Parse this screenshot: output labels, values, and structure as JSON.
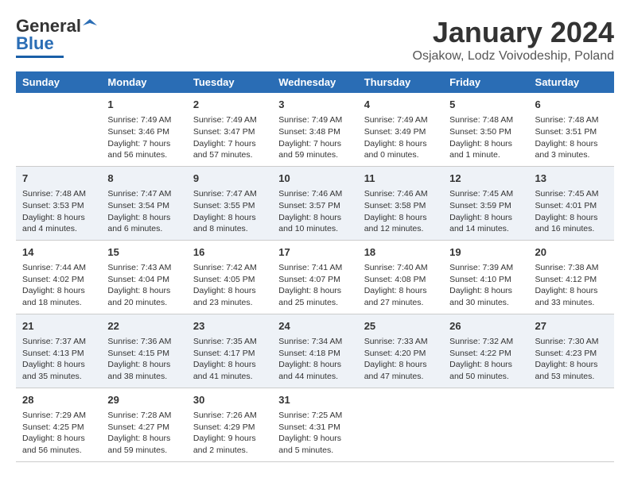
{
  "logo": {
    "line1": "General",
    "line2": "Blue"
  },
  "title": "January 2024",
  "subtitle": "Osjakow, Lodz Voivodeship, Poland",
  "days_of_week": [
    "Sunday",
    "Monday",
    "Tuesday",
    "Wednesday",
    "Thursday",
    "Friday",
    "Saturday"
  ],
  "weeks": [
    [
      {
        "day": "",
        "info": ""
      },
      {
        "day": "1",
        "info": "Sunrise: 7:49 AM\nSunset: 3:46 PM\nDaylight: 7 hours\nand 56 minutes."
      },
      {
        "day": "2",
        "info": "Sunrise: 7:49 AM\nSunset: 3:47 PM\nDaylight: 7 hours\nand 57 minutes."
      },
      {
        "day": "3",
        "info": "Sunrise: 7:49 AM\nSunset: 3:48 PM\nDaylight: 7 hours\nand 59 minutes."
      },
      {
        "day": "4",
        "info": "Sunrise: 7:49 AM\nSunset: 3:49 PM\nDaylight: 8 hours\nand 0 minutes."
      },
      {
        "day": "5",
        "info": "Sunrise: 7:48 AM\nSunset: 3:50 PM\nDaylight: 8 hours\nand 1 minute."
      },
      {
        "day": "6",
        "info": "Sunrise: 7:48 AM\nSunset: 3:51 PM\nDaylight: 8 hours\nand 3 minutes."
      }
    ],
    [
      {
        "day": "7",
        "info": "Sunrise: 7:48 AM\nSunset: 3:53 PM\nDaylight: 8 hours\nand 4 minutes."
      },
      {
        "day": "8",
        "info": "Sunrise: 7:47 AM\nSunset: 3:54 PM\nDaylight: 8 hours\nand 6 minutes."
      },
      {
        "day": "9",
        "info": "Sunrise: 7:47 AM\nSunset: 3:55 PM\nDaylight: 8 hours\nand 8 minutes."
      },
      {
        "day": "10",
        "info": "Sunrise: 7:46 AM\nSunset: 3:57 PM\nDaylight: 8 hours\nand 10 minutes."
      },
      {
        "day": "11",
        "info": "Sunrise: 7:46 AM\nSunset: 3:58 PM\nDaylight: 8 hours\nand 12 minutes."
      },
      {
        "day": "12",
        "info": "Sunrise: 7:45 AM\nSunset: 3:59 PM\nDaylight: 8 hours\nand 14 minutes."
      },
      {
        "day": "13",
        "info": "Sunrise: 7:45 AM\nSunset: 4:01 PM\nDaylight: 8 hours\nand 16 minutes."
      }
    ],
    [
      {
        "day": "14",
        "info": "Sunrise: 7:44 AM\nSunset: 4:02 PM\nDaylight: 8 hours\nand 18 minutes."
      },
      {
        "day": "15",
        "info": "Sunrise: 7:43 AM\nSunset: 4:04 PM\nDaylight: 8 hours\nand 20 minutes."
      },
      {
        "day": "16",
        "info": "Sunrise: 7:42 AM\nSunset: 4:05 PM\nDaylight: 8 hours\nand 23 minutes."
      },
      {
        "day": "17",
        "info": "Sunrise: 7:41 AM\nSunset: 4:07 PM\nDaylight: 8 hours\nand 25 minutes."
      },
      {
        "day": "18",
        "info": "Sunrise: 7:40 AM\nSunset: 4:08 PM\nDaylight: 8 hours\nand 27 minutes."
      },
      {
        "day": "19",
        "info": "Sunrise: 7:39 AM\nSunset: 4:10 PM\nDaylight: 8 hours\nand 30 minutes."
      },
      {
        "day": "20",
        "info": "Sunrise: 7:38 AM\nSunset: 4:12 PM\nDaylight: 8 hours\nand 33 minutes."
      }
    ],
    [
      {
        "day": "21",
        "info": "Sunrise: 7:37 AM\nSunset: 4:13 PM\nDaylight: 8 hours\nand 35 minutes."
      },
      {
        "day": "22",
        "info": "Sunrise: 7:36 AM\nSunset: 4:15 PM\nDaylight: 8 hours\nand 38 minutes."
      },
      {
        "day": "23",
        "info": "Sunrise: 7:35 AM\nSunset: 4:17 PM\nDaylight: 8 hours\nand 41 minutes."
      },
      {
        "day": "24",
        "info": "Sunrise: 7:34 AM\nSunset: 4:18 PM\nDaylight: 8 hours\nand 44 minutes."
      },
      {
        "day": "25",
        "info": "Sunrise: 7:33 AM\nSunset: 4:20 PM\nDaylight: 8 hours\nand 47 minutes."
      },
      {
        "day": "26",
        "info": "Sunrise: 7:32 AM\nSunset: 4:22 PM\nDaylight: 8 hours\nand 50 minutes."
      },
      {
        "day": "27",
        "info": "Sunrise: 7:30 AM\nSunset: 4:23 PM\nDaylight: 8 hours\nand 53 minutes."
      }
    ],
    [
      {
        "day": "28",
        "info": "Sunrise: 7:29 AM\nSunset: 4:25 PM\nDaylight: 8 hours\nand 56 minutes."
      },
      {
        "day": "29",
        "info": "Sunrise: 7:28 AM\nSunset: 4:27 PM\nDaylight: 8 hours\nand 59 minutes."
      },
      {
        "day": "30",
        "info": "Sunrise: 7:26 AM\nSunset: 4:29 PM\nDaylight: 9 hours\nand 2 minutes."
      },
      {
        "day": "31",
        "info": "Sunrise: 7:25 AM\nSunset: 4:31 PM\nDaylight: 9 hours\nand 5 minutes."
      },
      {
        "day": "",
        "info": ""
      },
      {
        "day": "",
        "info": ""
      },
      {
        "day": "",
        "info": ""
      }
    ]
  ]
}
